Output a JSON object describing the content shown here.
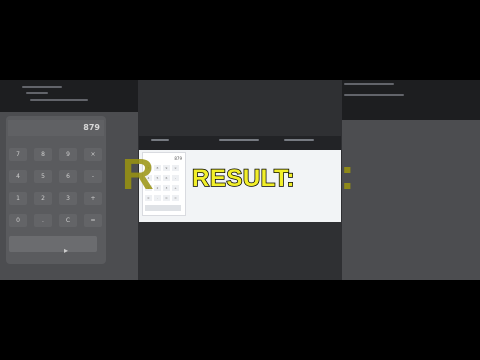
{
  "background": {
    "display_value": "879",
    "keys": [
      "7",
      "8",
      "9",
      "×",
      "4",
      "5",
      "6",
      "-",
      "1",
      "2",
      "3",
      "+",
      "0",
      ".",
      "C",
      "="
    ]
  },
  "foreground": {
    "display_value": "879",
    "keys": [
      "7",
      "8",
      "9",
      "×",
      "4",
      "5",
      "6",
      "-",
      "1",
      "2",
      "3",
      "+",
      "0",
      ".",
      "C",
      "="
    ]
  },
  "overlay": {
    "result_text": "RESULT:",
    "ghost_left": "R",
    "ghost_right": ":"
  },
  "colors": {
    "caption_yellow": "#f2ef2a",
    "panel_gray": "#4c4d50"
  }
}
